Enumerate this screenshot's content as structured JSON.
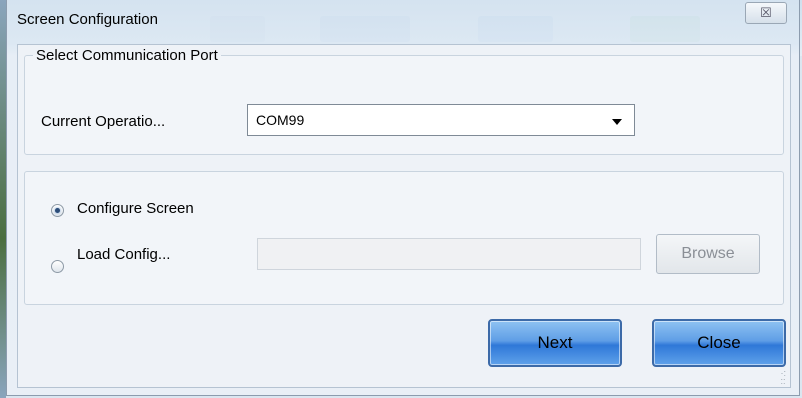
{
  "window": {
    "title": "Screen Configuration",
    "close_glyph": "☒"
  },
  "port_group": {
    "legend": "Select Communication Port",
    "current_label": "Current Operatio...",
    "selected_port": "COM99"
  },
  "mode": {
    "configure_label": "Configure Screen",
    "configure_checked": true,
    "load_label": "Load Config...",
    "load_checked": false,
    "config_path_value": "",
    "browse_label": "Browse"
  },
  "buttons": {
    "next_label": "Next",
    "close_label": "Close"
  },
  "colors": {
    "accent_button": "#5f9ee6",
    "button_border": "#3c6aa8"
  }
}
